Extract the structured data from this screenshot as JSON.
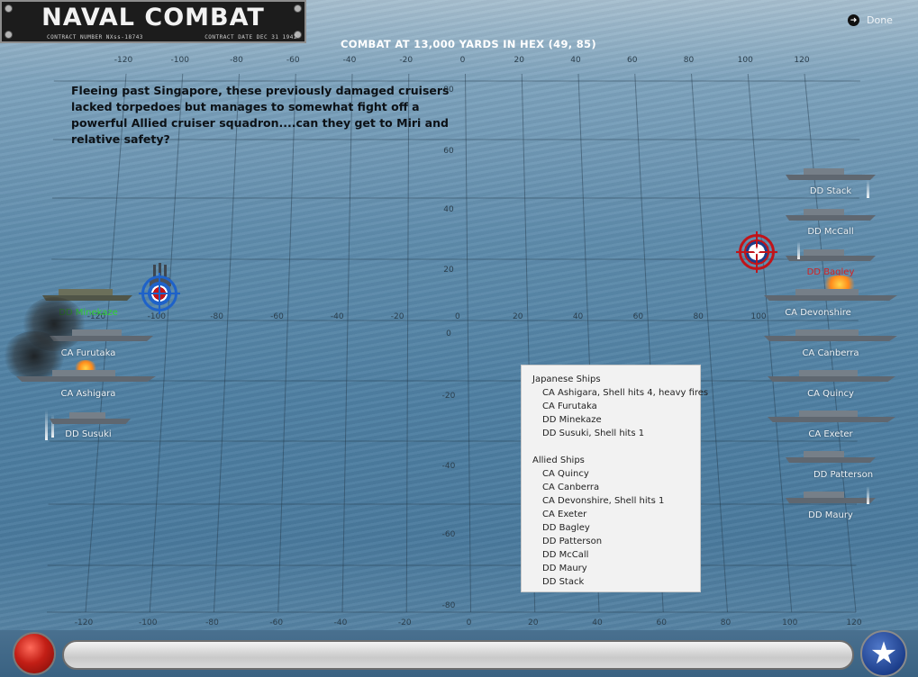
{
  "header": {
    "logo_title": "NAVAL COMBAT",
    "contract_number": "CONTRACT NUMBER  NXss-18743",
    "contract_date": "CONTRACT DATE DEC 31 1942",
    "combat_title": "COMBAT AT 13,000 YARDS IN HEX (49, 85)",
    "done_label": "Done",
    "done_icon": "arrow-right-icon"
  },
  "scenario_text": "Fleeing past Singapore, these previously damaged cruisers lacked torpedoes but manages to somewhat fight off a powerful Allied cruiser squadron....can they get to Miri and relative safety?",
  "grid": {
    "top_axis": [
      "-120",
      "-100",
      "-80",
      "-60",
      "-40",
      "-20",
      "0",
      "20",
      "40",
      "60",
      "80",
      "100",
      "120"
    ],
    "mid_axis": [
      "-120",
      "-100",
      "-80",
      "-60",
      "-40",
      "-20",
      "0",
      "20",
      "40",
      "60",
      "80",
      "100"
    ],
    "bottom_axis": [
      "-120",
      "-100",
      "-80",
      "-60",
      "-40",
      "-20",
      "0",
      "20",
      "40",
      "60",
      "80",
      "100",
      "120"
    ],
    "y_axis": [
      "80",
      "60",
      "40",
      "20",
      "0",
      "-20",
      "-40",
      "-60",
      "-80"
    ]
  },
  "japanese_ships": [
    {
      "name": "DD Minekaze",
      "status": "targeted"
    },
    {
      "name": "CA Furutaka",
      "status": "smoke"
    },
    {
      "name": "CA Ashigara",
      "status": "fire"
    },
    {
      "name": "DD Susuki",
      "status": "splash"
    }
  ],
  "allied_ships": [
    {
      "name": "DD Stack"
    },
    {
      "name": "DD McCall"
    },
    {
      "name": "DD Bagley"
    },
    {
      "name": "CA Devonshire"
    },
    {
      "name": "CA Canberra"
    },
    {
      "name": "CA Quincy"
    },
    {
      "name": "CA Exeter"
    },
    {
      "name": "DD Patterson"
    },
    {
      "name": "DD Maury"
    }
  ],
  "status_panel": {
    "japanese_header": "Japanese Ships",
    "japanese_rows": [
      "CA Ashigara, Shell hits 4,  heavy fires",
      "CA Furutaka",
      "DD Minekaze",
      "DD Susuki, Shell hits 1"
    ],
    "allied_header": "Allied Ships",
    "allied_rows": [
      "CA Quincy",
      "CA Canberra",
      "CA Devonshire, Shell hits 1",
      "CA Exeter",
      "DD Bagley",
      "DD Patterson",
      "DD McCall",
      "DD Maury",
      "DD Stack"
    ]
  },
  "controls": {
    "progress_fraction": 0.0,
    "fire_button_icon": "red-circle-icon",
    "next_button_icon": "star-icon"
  },
  "colors": {
    "sea": "#5f8cac",
    "allied_target": "#c1141a",
    "japanese_target": "#1e62c9",
    "highlight_red": "#d22222",
    "highlight_green": "#2fd12f"
  }
}
